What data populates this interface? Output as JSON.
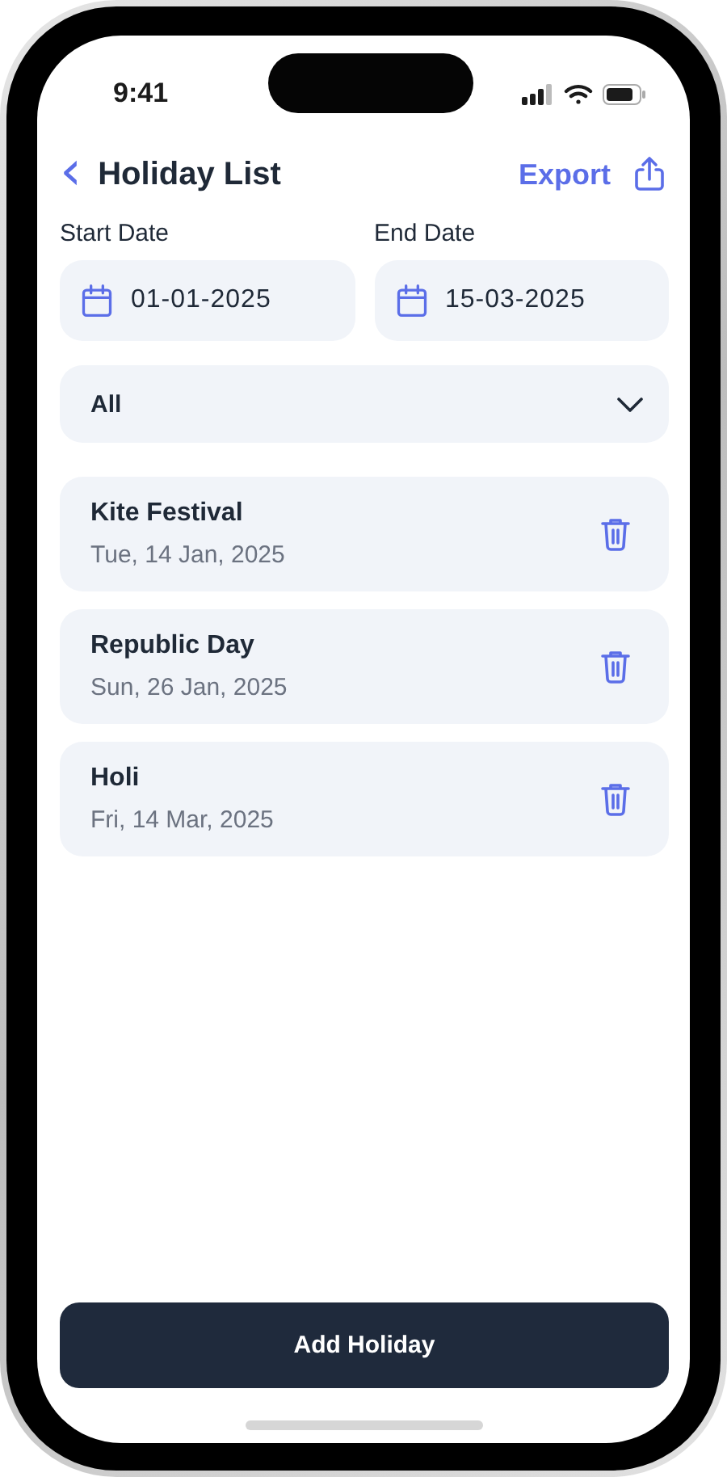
{
  "status_bar": {
    "time": "9:41"
  },
  "header": {
    "back": "‹",
    "title": "Holiday List",
    "action": "Export"
  },
  "date_range": [
    {
      "label": "Start Date",
      "value": "01-01-2025"
    },
    {
      "label": "End Date",
      "value": "15-03-2025"
    }
  ],
  "filter": {
    "value": "All"
  },
  "holidays": [
    {
      "name": "Kite Festival",
      "date": "Tue, 14 Jan, 2025"
    },
    {
      "name": "Republic Day",
      "date": "Sun, 26 Jan, 2025"
    },
    {
      "name": "Holi",
      "date": "Fri, 14 Mar, 2025"
    }
  ],
  "primary_button": "Add Holiday"
}
